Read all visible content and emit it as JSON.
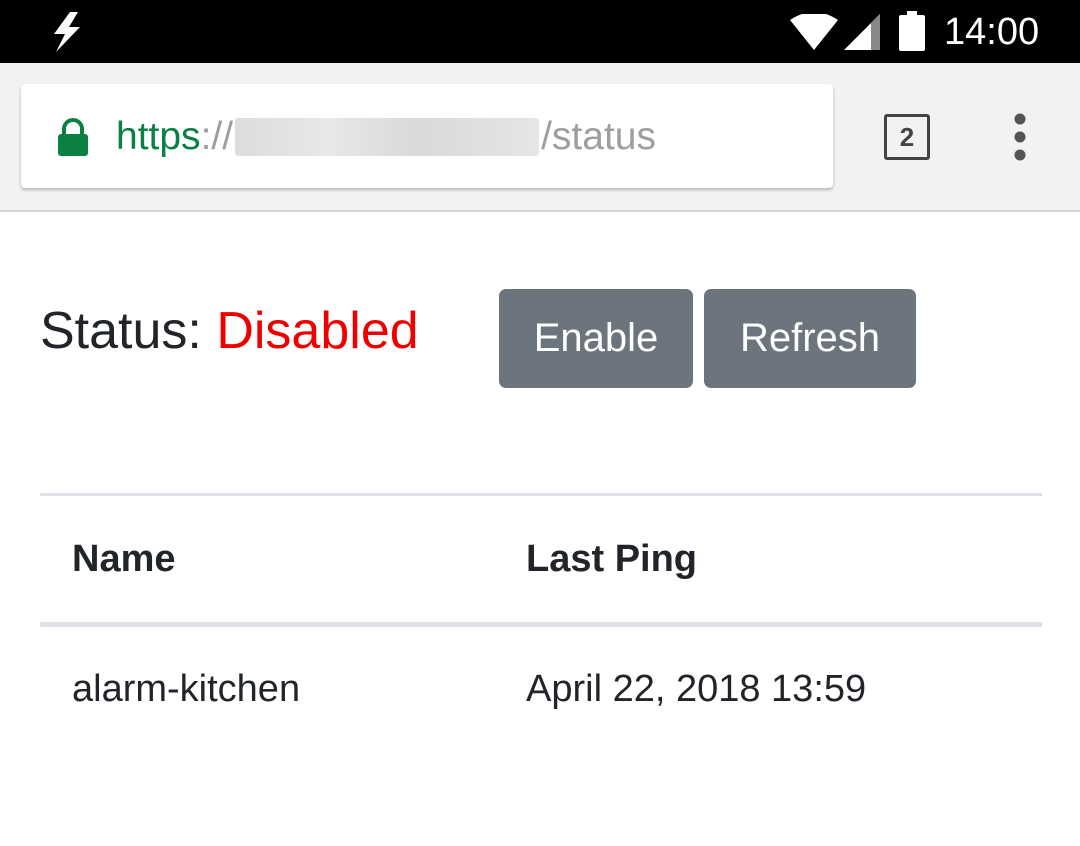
{
  "status_bar": {
    "time": "14:00",
    "icons": [
      "bolt-icon",
      "wifi-icon",
      "signal-icon",
      "battery-icon"
    ]
  },
  "browser": {
    "url_scheme": "https",
    "url_separator": "://",
    "url_path": "/status",
    "tab_count": "2",
    "icons": [
      "lock-icon",
      "more-vert-icon"
    ],
    "colors": {
      "secure": "#0b8043",
      "url_muted": "#9e9e9e"
    }
  },
  "page": {
    "status_label": "Status:",
    "status_value": "Disabled",
    "buttons": {
      "enable": "Enable",
      "refresh": "Refresh"
    },
    "table": {
      "headers": [
        "Name",
        "Last Ping"
      ],
      "rows": [
        [
          "alarm-kitchen",
          "April 22, 2018 13:59"
        ]
      ]
    },
    "colors": {
      "status_disabled": "#ee0000",
      "button_bg": "#6c757d",
      "text": "#212529"
    }
  }
}
